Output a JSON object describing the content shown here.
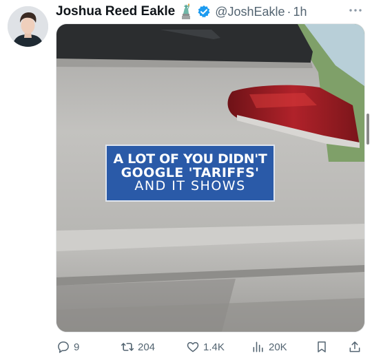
{
  "tweet": {
    "author_name": "Joshua Reed Eakle",
    "emoji_icon": "statue-of-liberty-icon",
    "verified_icon": "verified-badge-icon",
    "handle": "@JoshEakle",
    "separator": "·",
    "time": "1h",
    "media": {
      "sticker_lines": [
        "A LOT OF YOU DIDN'T",
        "GOOGLE 'TARIFFS'",
        "AND IT SHOWS"
      ]
    },
    "actions": {
      "replies": "9",
      "reposts": "204",
      "likes": "1.4K",
      "views": "20K"
    }
  },
  "colors": {
    "accent": "#1d9bf0",
    "text_primary": "#0f1419",
    "text_secondary": "#536471",
    "sticker_blue": "#2a5aa8",
    "car_silver": "#b9b8b5",
    "tail_light_red": "#9e1a22"
  }
}
